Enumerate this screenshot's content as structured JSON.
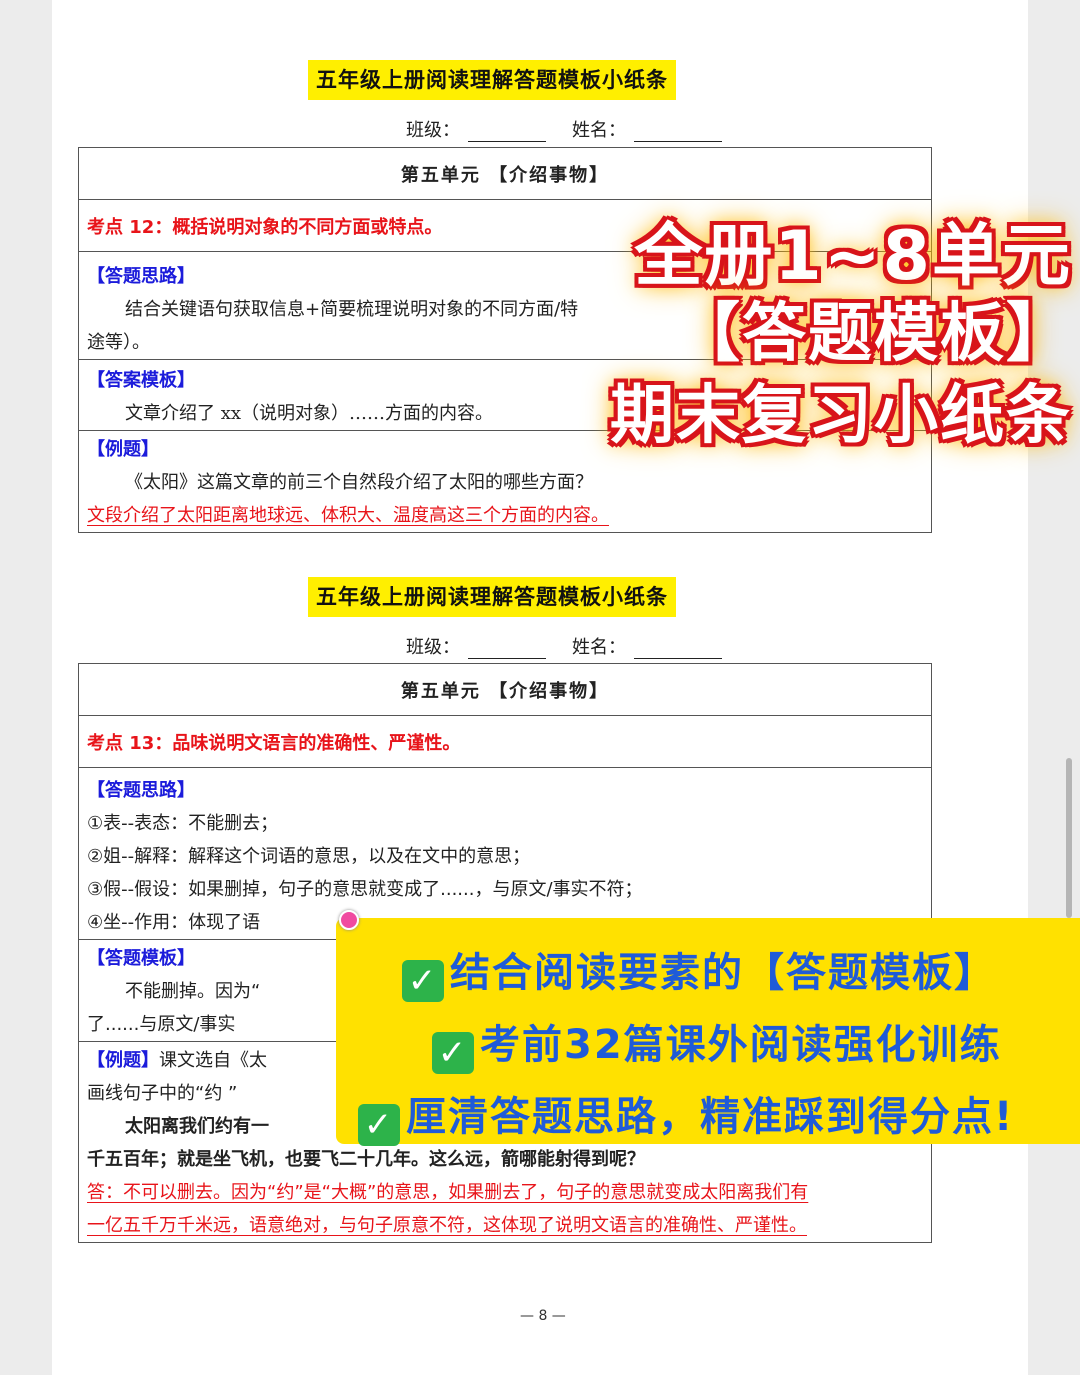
{
  "doc_title": "五年级上册阅读理解答题模板小纸条",
  "class_label": "班级：",
  "name_label": "姓名：",
  "unit_title": "第五单元  【介绍事物】",
  "card1": {
    "point": "考点 12：概括说明对象的不同方面或特点。",
    "approach_head": "【答题思路】",
    "approach_line1": "结合关键语句获取信息+简要梳理说明对象的不同方面/特",
    "approach_line2": "途等）。",
    "template_head": "【答案模板】",
    "template_line": "文章介绍了 xx（说明对象）……方面的内容。",
    "example_head": "【例题】",
    "example_q": "《太阳》这篇文章的前三个自然段介绍了太阳的哪些方面？",
    "example_a": "文段介绍了太阳距离地球远、体积大、温度高这三个方面的内容。"
  },
  "card2": {
    "point": "考点 13：品味说明文语言的准确性、严谨性。",
    "approach_head": "【答题思路】",
    "steps": [
      "①表--表态：不能删去；",
      "②姐--解释：解释这个词语的意思，以及在文中的意思；",
      "③假--假设：如果删掉，句子的意思就变成了......，与原文/事实不符；",
      "④坐--作用：体现了语"
    ],
    "template_head": "【答题模板】",
    "template_line1": "不能删掉。因为“",
    "template_line2": "了......与原文/事实",
    "example_head": "【例题】",
    "example_intro": "课文选自《太",
    "example_line2": "画线句子中的“约 ”",
    "example_line3": "太阳离我们约有一",
    "example_line4": "千五百年；就是坐飞机，也要飞二十几年。这么远，箭哪能射得到呢？",
    "answer_line1": "答：不可以删去。因为“约”是“大概”的意思，如果删去了，句子的意思就变成太阳离我们有",
    "answer_line2": "一亿五千万千米远，语意绝对，与句子原意不符，这体现了说明文语言的准确性、严谨性。"
  },
  "overlay": {
    "headline1": "全册1~8单元",
    "headline2": "【答题模板】",
    "headline3": "期末复习小纸条",
    "banner_items": [
      "结合阅读要素的【答题模板】",
      "考前32篇课外阅读强化训练",
      "厘清答题思路，精准踩到得分点!"
    ]
  },
  "page_number": "— 8 —",
  "colors": {
    "title_highlight": "#ffef00",
    "unit_blue": "#1c1cdb",
    "point_red": "#e8141a",
    "banner_yellow": "#ffe100",
    "banner_text": "#1f5bd8",
    "check_green": "#2db34a"
  }
}
